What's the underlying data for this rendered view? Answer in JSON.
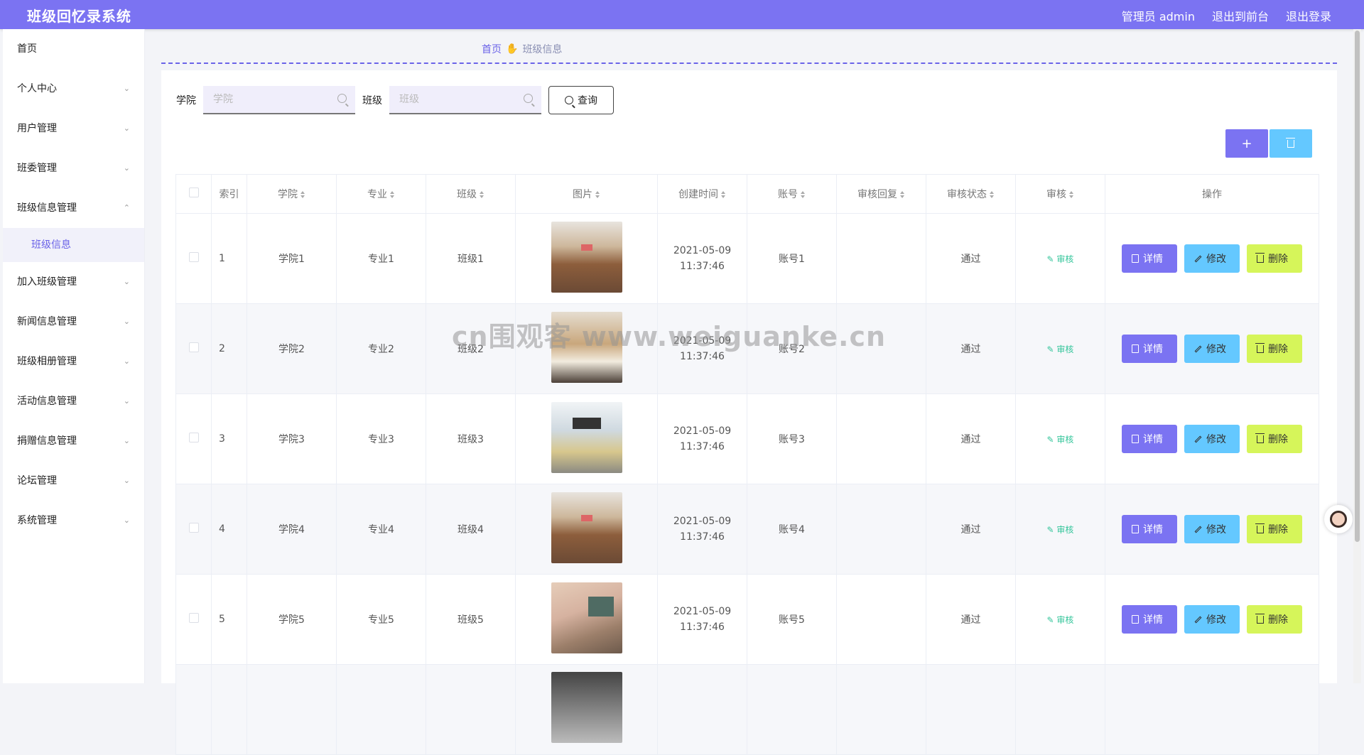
{
  "header": {
    "title": "班级回忆录系统",
    "admin": "管理员 admin",
    "front": "退出到前台",
    "logout": "退出登录"
  },
  "sidebar": {
    "items": [
      {
        "label": "首页"
      },
      {
        "label": "个人中心"
      },
      {
        "label": "用户管理"
      },
      {
        "label": "班委管理"
      },
      {
        "label": "班级信息管理"
      },
      {
        "label": "班级信息"
      },
      {
        "label": "加入班级管理"
      },
      {
        "label": "新闻信息管理"
      },
      {
        "label": "班级相册管理"
      },
      {
        "label": "活动信息管理"
      },
      {
        "label": "捐赠信息管理"
      },
      {
        "label": "论坛管理"
      },
      {
        "label": "系统管理"
      }
    ]
  },
  "breadcrumb": {
    "home": "首页",
    "current": "班级信息"
  },
  "search": {
    "college_label": "学院",
    "college_placeholder": "学院",
    "class_label": "班级",
    "class_placeholder": "班级",
    "query_label": "查询"
  },
  "actions": {
    "add": "+"
  },
  "table": {
    "headers": [
      "索引",
      "学院",
      "专业",
      "班级",
      "图片",
      "创建时间",
      "账号",
      "审核回复",
      "审核状态",
      "审核",
      "操作"
    ],
    "rows": [
      {
        "index": "1",
        "college": "学院1",
        "major": "专业1",
        "class": "班级1",
        "time": "2021-05-09 11:37:46",
        "account": "账号1",
        "reply": "",
        "status": "通过",
        "audit": "审核"
      },
      {
        "index": "2",
        "college": "学院2",
        "major": "专业2",
        "class": "班级2",
        "time": "2021-05-09 11:37:46",
        "account": "账号2",
        "reply": "",
        "status": "通过",
        "audit": "审核"
      },
      {
        "index": "3",
        "college": "学院3",
        "major": "专业3",
        "class": "班级3",
        "time": "2021-05-09 11:37:46",
        "account": "账号3",
        "reply": "",
        "status": "通过",
        "audit": "审核"
      },
      {
        "index": "4",
        "college": "学院4",
        "major": "专业4",
        "class": "班级4",
        "time": "2021-05-09 11:37:46",
        "account": "账号4",
        "reply": "",
        "status": "通过",
        "audit": "审核"
      },
      {
        "index": "5",
        "college": "学院5",
        "major": "专业5",
        "class": "班级5",
        "time": "2021-05-09 11:37:46",
        "account": "账号5",
        "reply": "",
        "status": "通过",
        "audit": "审核"
      }
    ],
    "op_detail": "详情",
    "op_edit": "修改",
    "op_delete": "删除"
  },
  "watermark": "cn围观客 www.weiguanke.cn",
  "colors": {
    "primary": "#7b73f2",
    "edit": "#64c8ff",
    "delete": "#d6f55a",
    "audit": "#33c59a"
  }
}
